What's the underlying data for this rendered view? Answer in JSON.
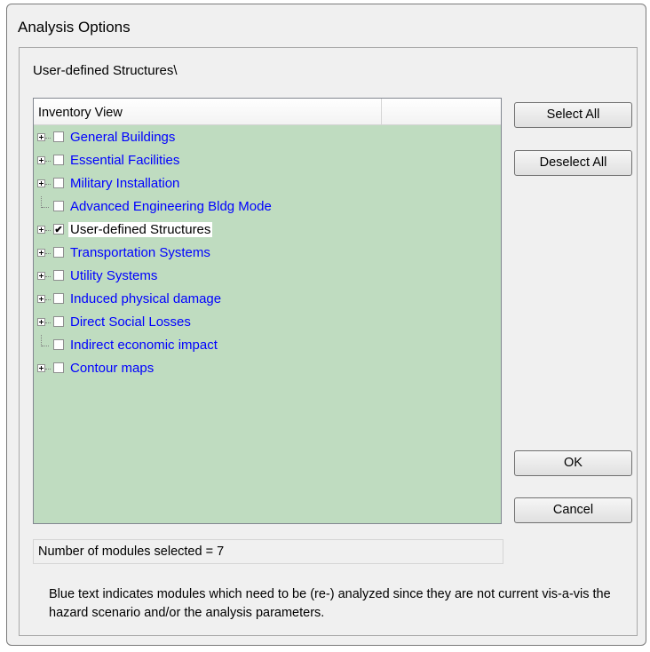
{
  "window": {
    "title": "Analysis Options"
  },
  "path_label": "User-defined Structures\\",
  "tree": {
    "header": "Inventory View",
    "items": [
      {
        "label": "General Buildings",
        "checked": false,
        "expandable": true,
        "current": false
      },
      {
        "label": "Essential Facilities",
        "checked": false,
        "expandable": true,
        "current": false
      },
      {
        "label": "Military Installation",
        "checked": false,
        "expandable": true,
        "current": false
      },
      {
        "label": "Advanced Engineering Bldg Mode",
        "checked": false,
        "expandable": false,
        "current": false
      },
      {
        "label": "User-defined Structures",
        "checked": true,
        "expandable": true,
        "current": true
      },
      {
        "label": "Transportation Systems",
        "checked": false,
        "expandable": true,
        "current": false
      },
      {
        "label": "Utility Systems",
        "checked": false,
        "expandable": true,
        "current": false
      },
      {
        "label": "Induced physical damage",
        "checked": false,
        "expandable": true,
        "current": false
      },
      {
        "label": "Direct Social Losses",
        "checked": false,
        "expandable": true,
        "current": false
      },
      {
        "label": "Indirect economic impact",
        "checked": false,
        "expandable": false,
        "current": false
      },
      {
        "label": "Contour maps",
        "checked": false,
        "expandable": true,
        "current": false
      }
    ]
  },
  "buttons": {
    "select_all": "Select All",
    "deselect_all": "Deselect All",
    "ok": "OK",
    "cancel": "Cancel"
  },
  "status": "Number of modules selected = 7",
  "note": "Blue text indicates modules which need to be (re-) analyzed since they are not current vis-a-vis the hazard scenario and/or the analysis parameters.",
  "colors": {
    "tree_background": "#bfdcc0",
    "stale_text": "#0000ff",
    "current_text": "#000000"
  },
  "icons": {
    "expand": "plus-box-icon",
    "checked": "checkmark-icon"
  }
}
